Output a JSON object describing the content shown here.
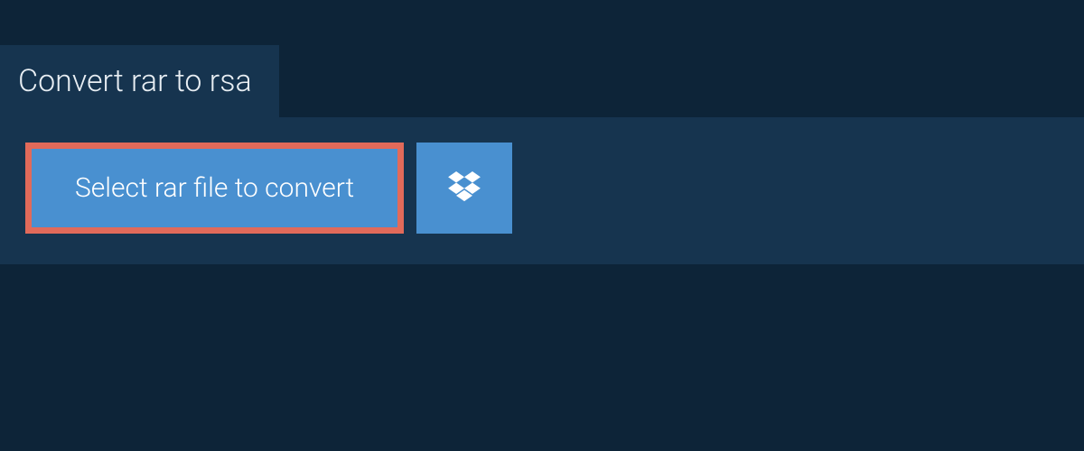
{
  "tab": {
    "title": "Convert rar to rsa"
  },
  "actions": {
    "select_file_label": "Select rar file to convert"
  },
  "colors": {
    "page_bg": "#0d2438",
    "panel_bg": "#16344f",
    "button_bg": "#4990d0",
    "button_border": "#e16a5a",
    "text_light": "#e8eef3",
    "text_white": "#ffffff"
  }
}
